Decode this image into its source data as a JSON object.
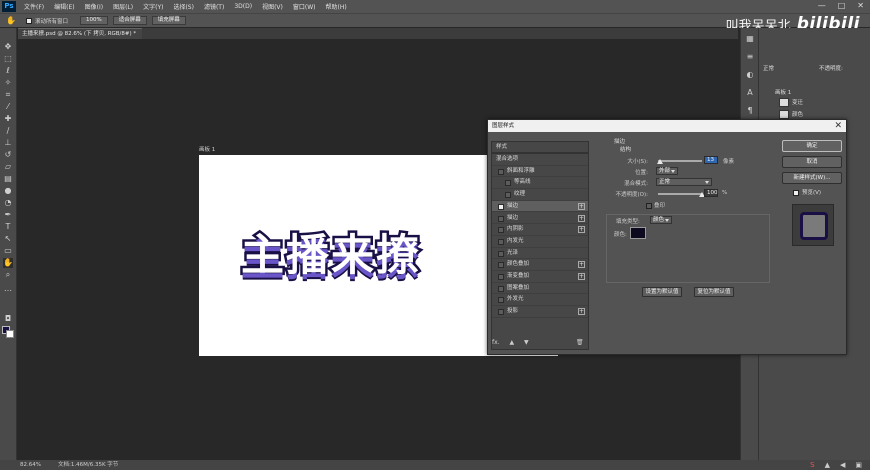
{
  "menu": {
    "logo": "Ps",
    "items": [
      "文件(F)",
      "编辑(E)",
      "图像(I)",
      "图层(L)",
      "文字(Y)",
      "选择(S)",
      "滤镜(T)",
      "3D(D)",
      "视图(V)",
      "窗口(W)",
      "帮助(H)"
    ],
    "window_controls": [
      "—",
      "□",
      "✕"
    ]
  },
  "options": {
    "scroll_all_windows": "滚动所有窗口",
    "zoom": "100%",
    "fit_screen": "适合屏幕",
    "fill_screen": "填充屏幕"
  },
  "watermark": {
    "text": "叫我呆呆北",
    "brand": "bilibili"
  },
  "document": {
    "tab": "主播来撩.psd @ 82.6% (下 拷贝, RGB/8#) *",
    "artboard_label": "画板 1",
    "canvas_text": "主播来撩",
    "text_fill": "#ffffff",
    "stroke_color": "#1a1046",
    "shadow_color": "#6b56c9"
  },
  "status": {
    "zoom": "82.64%",
    "doc": "文档:1.46M/6.35K 字节"
  },
  "right_panel": {
    "mode": "正常",
    "opacity_label": "不透明度:",
    "artboard": "画板 1",
    "layers": [
      "变迁",
      "颜色"
    ]
  },
  "dialog": {
    "title": "图层样式",
    "close": "✕",
    "list_header": "样式",
    "items": [
      {
        "label": "混合选项",
        "checkbox": false,
        "plus": false,
        "checked": false,
        "indent": 0
      },
      {
        "label": "斜面和浮雕",
        "checkbox": true,
        "plus": false,
        "checked": false,
        "indent": 0
      },
      {
        "label": "等高线",
        "checkbox": true,
        "plus": false,
        "checked": false,
        "indent": 1
      },
      {
        "label": "纹理",
        "checkbox": true,
        "plus": false,
        "checked": false,
        "indent": 1
      },
      {
        "label": "描边",
        "checkbox": true,
        "plus": true,
        "checked": true,
        "indent": 0
      },
      {
        "label": "描边",
        "checkbox": true,
        "plus": true,
        "checked": false,
        "indent": 0
      },
      {
        "label": "内阴影",
        "checkbox": true,
        "plus": true,
        "checked": false,
        "indent": 0
      },
      {
        "label": "内发光",
        "checkbox": true,
        "plus": false,
        "checked": false,
        "indent": 0
      },
      {
        "label": "光泽",
        "checkbox": true,
        "plus": false,
        "checked": false,
        "indent": 0
      },
      {
        "label": "颜色叠加",
        "checkbox": true,
        "plus": true,
        "checked": false,
        "indent": 0
      },
      {
        "label": "渐变叠加",
        "checkbox": true,
        "plus": true,
        "checked": false,
        "indent": 0
      },
      {
        "label": "图案叠加",
        "checkbox": true,
        "plus": false,
        "checked": false,
        "indent": 0
      },
      {
        "label": "外发光",
        "checkbox": true,
        "plus": false,
        "checked": false,
        "indent": 0
      },
      {
        "label": "投影",
        "checkbox": true,
        "plus": true,
        "checked": false,
        "indent": 0
      }
    ],
    "footer": [
      "fx.",
      "▲",
      "▼",
      "🗑"
    ],
    "settings": {
      "section": "描边",
      "structure": "结构",
      "size_label": "大小(S):",
      "size_value": "13",
      "size_unit": "像素",
      "position_label": "位置:",
      "position_value": "外部",
      "blend_label": "混合模式:",
      "blend_value": "正常",
      "opacity_label": "不透明度(O):",
      "opacity_value": "100",
      "opacity_unit": "%",
      "overprint": "叠印",
      "fill_type_label": "填充类型:",
      "fill_type_value": "颜色",
      "color_label": "颜色:",
      "color_value": "#0d0a20",
      "set_default": "设置为默认值",
      "reset_default": "复位为默认值"
    },
    "buttons": {
      "ok": "确定",
      "cancel": "取消",
      "new_style": "新建样式(W)...",
      "preview": "预览(V)"
    }
  }
}
